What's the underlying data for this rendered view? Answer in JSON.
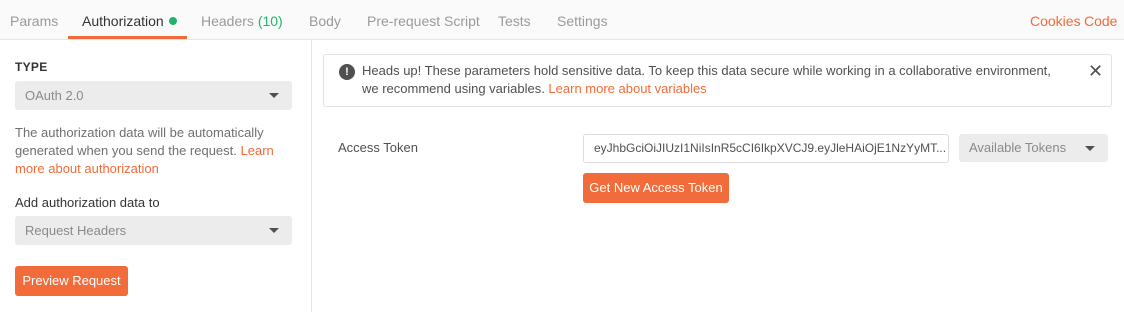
{
  "tabs": [
    {
      "label": "Params"
    },
    {
      "label": "Authorization"
    },
    {
      "label": "Headers",
      "count": "(10)"
    },
    {
      "label": "Body"
    },
    {
      "label": "Pre-request Script"
    },
    {
      "label": "Tests"
    },
    {
      "label": "Settings"
    }
  ],
  "top_links": {
    "cookies": "Cookies",
    "code": "Code"
  },
  "left": {
    "type_label": "TYPE",
    "type_value": "OAuth 2.0",
    "description": "The authorization data will be automatically generated when you send the request. ",
    "description_link": "Learn more about authorization",
    "add_label": "Add authorization data to",
    "add_value": "Request Headers",
    "preview_button": "Preview Request"
  },
  "alert": {
    "text": "Heads up! These parameters hold sensitive data. To keep this data secure while working in a collaborative environment, we recommend using variables. ",
    "link": "Learn more about variables",
    "icon_glyph": "!",
    "close_glyph": "✕"
  },
  "token": {
    "label": "Access Token",
    "value": "eyJhbGciOiJIUzI1NiIsInR5cCI6IkpXVCJ9.eyJleHAiOjE1NzYyMT...",
    "available_tokens": "Available Tokens",
    "get_button": "Get New Access Token"
  },
  "colors": {
    "accent": "#f26b3a",
    "success": "#23b26d"
  }
}
